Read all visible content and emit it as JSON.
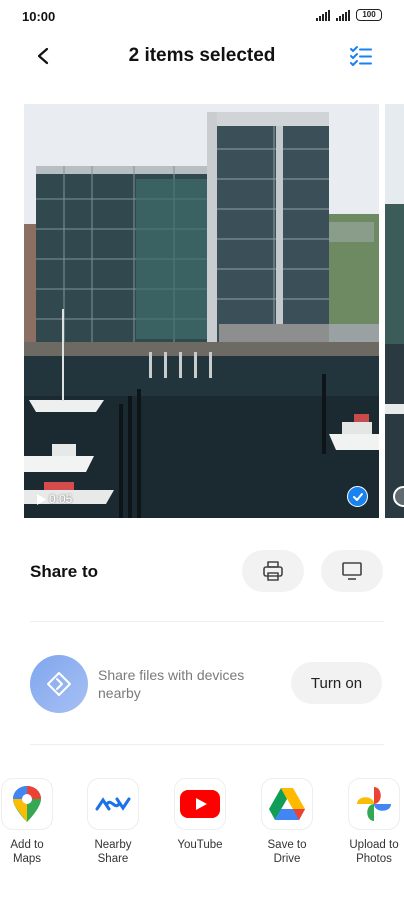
{
  "status_bar": {
    "time": "10:00",
    "battery": "100"
  },
  "header": {
    "title": "2 items selected"
  },
  "gallery": {
    "duration": "0:05"
  },
  "share": {
    "title": "Share to"
  },
  "nearby": {
    "description": "Share files with devices nearby",
    "button_label": "Turn on"
  },
  "apps": [
    {
      "label": "Add to\nMaps",
      "icon": "google-maps-icon"
    },
    {
      "label": "Nearby\nShare",
      "icon": "nearby-share-icon"
    },
    {
      "label": "YouTube",
      "icon": "youtube-icon"
    },
    {
      "label": "Save to\nDrive",
      "icon": "google-drive-icon"
    },
    {
      "label": "Upload to\nPhotos",
      "icon": "google-photos-icon"
    }
  ],
  "colors": {
    "accent": "#1a82f0",
    "nearby_badge": "#8fb0f0",
    "button_bg": "#f2f2f2"
  }
}
